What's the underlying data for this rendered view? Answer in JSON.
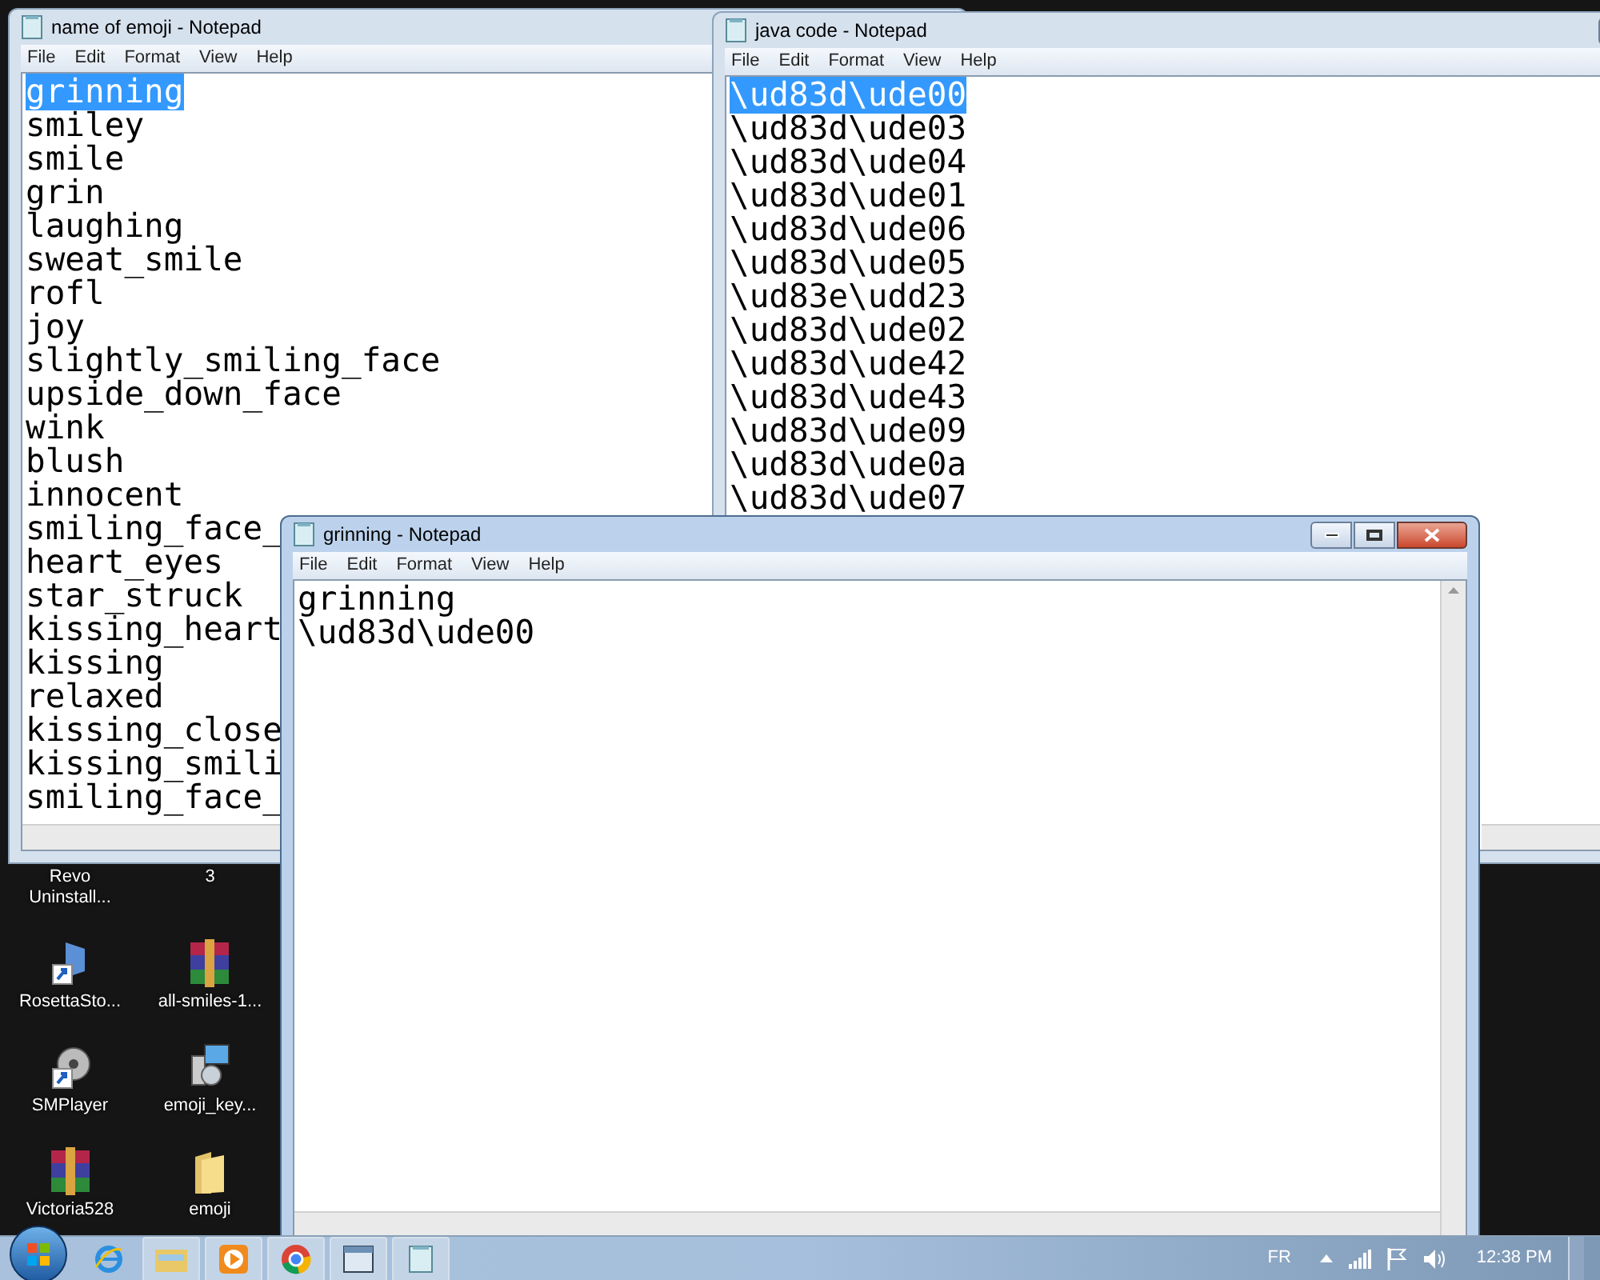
{
  "windows": [
    {
      "title": "name of emoji - Notepad",
      "active": false,
      "menu": [
        "File",
        "Edit",
        "Format",
        "View",
        "Help"
      ],
      "lines": [
        {
          "text": "grinning",
          "selected": true
        },
        {
          "text": "smiley",
          "selected": false
        },
        {
          "text": "smile",
          "selected": false
        },
        {
          "text": "grin",
          "selected": false
        },
        {
          "text": "laughing",
          "selected": false
        },
        {
          "text": "sweat_smile",
          "selected": false
        },
        {
          "text": "rofl",
          "selected": false
        },
        {
          "text": "joy",
          "selected": false
        },
        {
          "text": "slightly_smiling_face",
          "selected": false
        },
        {
          "text": "upside_down_face",
          "selected": false
        },
        {
          "text": "wink",
          "selected": false
        },
        {
          "text": "blush",
          "selected": false
        },
        {
          "text": "innocent",
          "selected": false
        },
        {
          "text": "smiling_face_",
          "selected": false
        },
        {
          "text": "heart_eyes",
          "selected": false
        },
        {
          "text": "star_struck",
          "selected": false
        },
        {
          "text": "kissing_heart",
          "selected": false
        },
        {
          "text": "kissing",
          "selected": false
        },
        {
          "text": "relaxed",
          "selected": false
        },
        {
          "text": "kissing_close",
          "selected": false
        },
        {
          "text": "kissing_smili",
          "selected": false
        },
        {
          "text": "smiling_face_",
          "selected": false
        }
      ]
    },
    {
      "title": "java code - Notepad",
      "active": false,
      "menu": [
        "File",
        "Edit",
        "Format",
        "View",
        "Help"
      ],
      "lines": [
        {
          "text": "\\ud83d\\ude00",
          "selected": true
        },
        {
          "text": "\\ud83d\\ude03",
          "selected": false
        },
        {
          "text": "\\ud83d\\ude04",
          "selected": false
        },
        {
          "text": "\\ud83d\\ude01",
          "selected": false
        },
        {
          "text": "\\ud83d\\ude06",
          "selected": false
        },
        {
          "text": "\\ud83d\\ude05",
          "selected": false
        },
        {
          "text": "\\ud83e\\udd23",
          "selected": false
        },
        {
          "text": "\\ud83d\\ude02",
          "selected": false
        },
        {
          "text": "\\ud83d\\ude42",
          "selected": false
        },
        {
          "text": "\\ud83d\\ude43",
          "selected": false
        },
        {
          "text": "\\ud83d\\ude09",
          "selected": false
        },
        {
          "text": "\\ud83d\\ude0a",
          "selected": false
        },
        {
          "text": "\\ud83d\\ude07",
          "selected": false
        }
      ]
    },
    {
      "title": "grinning - Notepad",
      "active": true,
      "menu": [
        "File",
        "Edit",
        "Format",
        "View",
        "Help"
      ],
      "lines": [
        {
          "text": "grinning",
          "selected": false
        },
        {
          "text": "\\ud83d\\ude00",
          "selected": false
        }
      ]
    }
  ],
  "desktop_icons": [
    {
      "label": "Revo Uninstall...",
      "kind": "hidden"
    },
    {
      "label": "3",
      "kind": "hidden"
    },
    {
      "label": "RosettaSto...",
      "kind": "shortcut"
    },
    {
      "label": "all-smiles-1...",
      "kind": "archive"
    },
    {
      "label": "SMPlayer",
      "kind": "player"
    },
    {
      "label": "emoji_key...",
      "kind": "installer"
    },
    {
      "label": "Victoria528",
      "kind": "archive"
    },
    {
      "label": "emoji",
      "kind": "folder"
    }
  ],
  "taskbar": {
    "items": [
      {
        "kind": "ie"
      },
      {
        "kind": "explorer"
      },
      {
        "kind": "media"
      },
      {
        "kind": "chrome"
      },
      {
        "kind": "window"
      },
      {
        "kind": "notepad"
      }
    ],
    "language": "FR",
    "clock": "12:38 PM"
  }
}
